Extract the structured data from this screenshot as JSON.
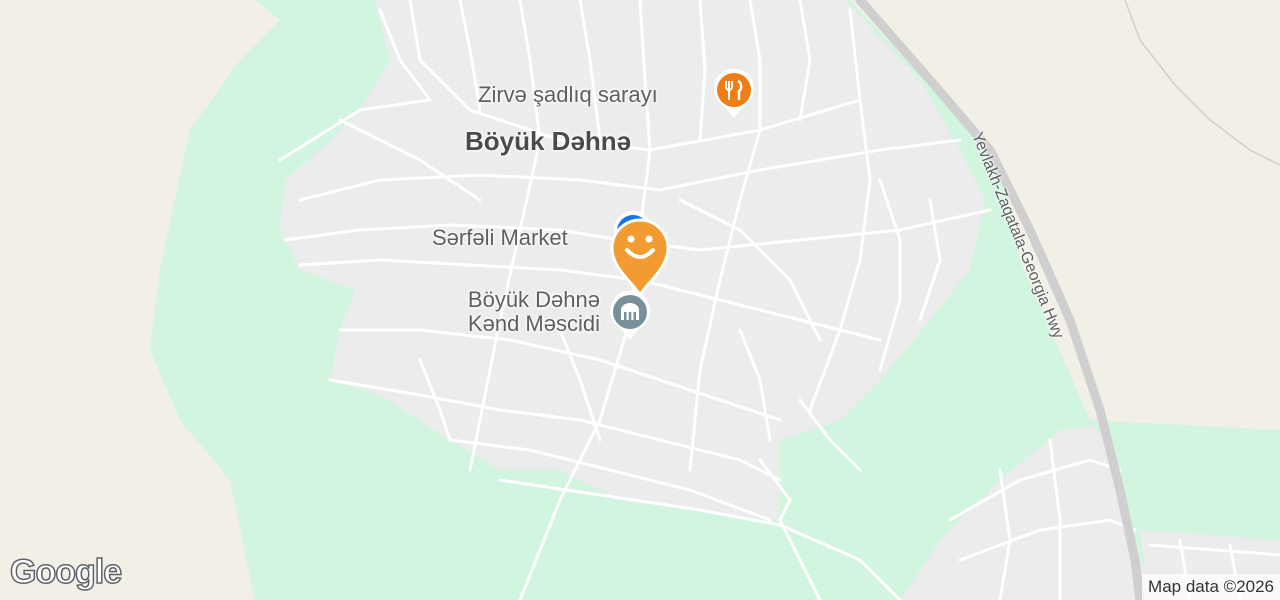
{
  "map": {
    "town_label": "Böyük Dəhnə",
    "highway_label": "Yevlakh-Zaqatala-Georgia Hwy",
    "pois": [
      {
        "name": "Zirvə şadlıq sarayı",
        "icon": "restaurant-icon",
        "color": "#f07e14"
      },
      {
        "name": "Sərfəli Market",
        "icon": "shopping-icon",
        "color": "#1a73e8"
      },
      {
        "name_line1": "Böyük Dəhnə",
        "name_line2": "Kənd Məscidi",
        "icon": "mosque-icon",
        "color": "#78909c"
      }
    ],
    "location_marker": {
      "icon": "smiley-pin-icon",
      "color": "#f29b30"
    },
    "colors": {
      "land": "#f1efe6",
      "green": "#d2f5e0",
      "urban": "#ececec",
      "road": "#ffffff",
      "highway": "#cfcfcf"
    }
  },
  "footer": {
    "logo": "Google",
    "attribution": "Map data ©2026"
  }
}
